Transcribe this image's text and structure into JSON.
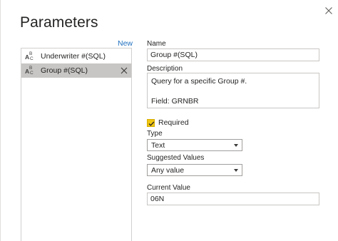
{
  "dialog": {
    "title": "Parameters",
    "close_icon": "close-icon"
  },
  "parameters_list": {
    "new_label": "New",
    "items": [
      {
        "type_icon": "abc-text-type-icon",
        "type_letters": [
          "A",
          "B",
          "C"
        ],
        "label": "Underwriter #(SQL)",
        "selected": false
      },
      {
        "type_icon": "abc-text-type-icon",
        "type_letters": [
          "A",
          "B",
          "C"
        ],
        "label": "Group #(SQL)",
        "selected": true,
        "remove_icon": "close-icon"
      }
    ]
  },
  "form": {
    "name_label": "Name",
    "name_value": "Group #(SQL)",
    "description_label": "Description",
    "description_lines": [
      "Query for a specific Group #.",
      "",
      "Field:  GRNBR"
    ],
    "required_label": "Required",
    "required_checked": true,
    "type_label": "Type",
    "type_value": "Text",
    "suggested_values_label": "Suggested Values",
    "suggested_values_value": "Any value",
    "current_value_label": "Current Value",
    "current_value": "06N"
  },
  "colors": {
    "accent_link": "#1e6fbe",
    "checkbox_fill": "#f2c811",
    "selected_row": "#c8c6c4"
  }
}
